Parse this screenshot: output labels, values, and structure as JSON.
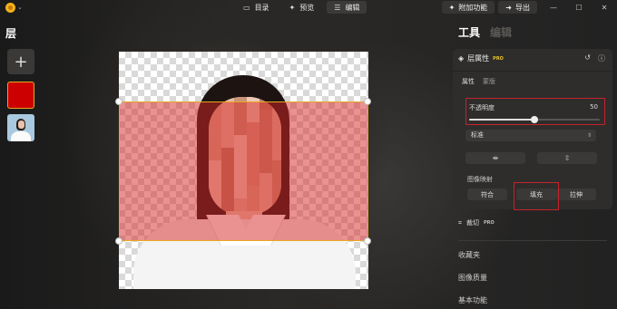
{
  "topbar": {
    "tabs": [
      {
        "label": "目录",
        "icon": "folder-icon",
        "glyph": "▭"
      },
      {
        "label": "预览",
        "icon": "magic-wand-icon",
        "glyph": "✦"
      },
      {
        "label": "编辑",
        "icon": "sliders-icon",
        "glyph": "☰"
      }
    ],
    "addons_label": "附加功能",
    "export_label": "导出",
    "minimize_glyph": "—",
    "maximize_glyph": "☐",
    "close_glyph": "✕"
  },
  "left_panel": {
    "title": "层",
    "add_glyph": "+"
  },
  "right_panel": {
    "title_tools": "工具",
    "title_edit": "编辑",
    "layer_props": {
      "title": "层属性",
      "pro_badge": "PRO",
      "reset_glyph": "↺",
      "info_glyph": "ⓘ",
      "subtabs": [
        "属性",
        "蒙版"
      ],
      "opacity_label": "不透明度",
      "opacity_value": "50",
      "opacity_fraction": 0.5,
      "blend_mode": "标准",
      "updown_glyph": "⇕",
      "flip_h_glyph": "⇼",
      "flip_v_glyph": "⇳",
      "image_mapping_label": "图像映射",
      "mapping_options": [
        "符合",
        "填充",
        "拉伸"
      ]
    },
    "crop_label": "裁切",
    "crop_badge": "PRO",
    "sections": [
      "收藏夹",
      "图像质量",
      "基本功能"
    ]
  },
  "colors": {
    "accent_orange": "#e8a623",
    "highlight_red": "#c6222b",
    "layer_red": "#cc0000"
  }
}
